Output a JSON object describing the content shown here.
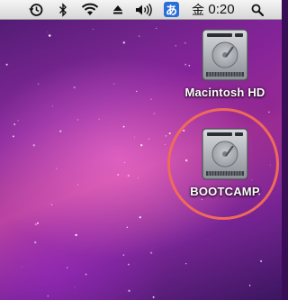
{
  "menubar": {
    "icons": [
      "time-machine-icon",
      "bluetooth-icon",
      "wifi-icon",
      "eject-icon",
      "volume-icon",
      "ime-icon",
      "spotlight-search-icon"
    ],
    "ime_label": "あ",
    "day": "金",
    "time": "0:20"
  },
  "desktop": {
    "items": [
      {
        "label": "Macintosh HD",
        "icon": "hard-drive-icon"
      },
      {
        "label": "BOOTCAMP",
        "icon": "hard-drive-icon",
        "highlighted": true
      }
    ]
  },
  "colors": {
    "menubar": "#e6e6e6",
    "ime_badge": "#2a6fd8",
    "highlight_ring": "#f06a5a",
    "wallpaper_primary": "#9a3aa0"
  }
}
